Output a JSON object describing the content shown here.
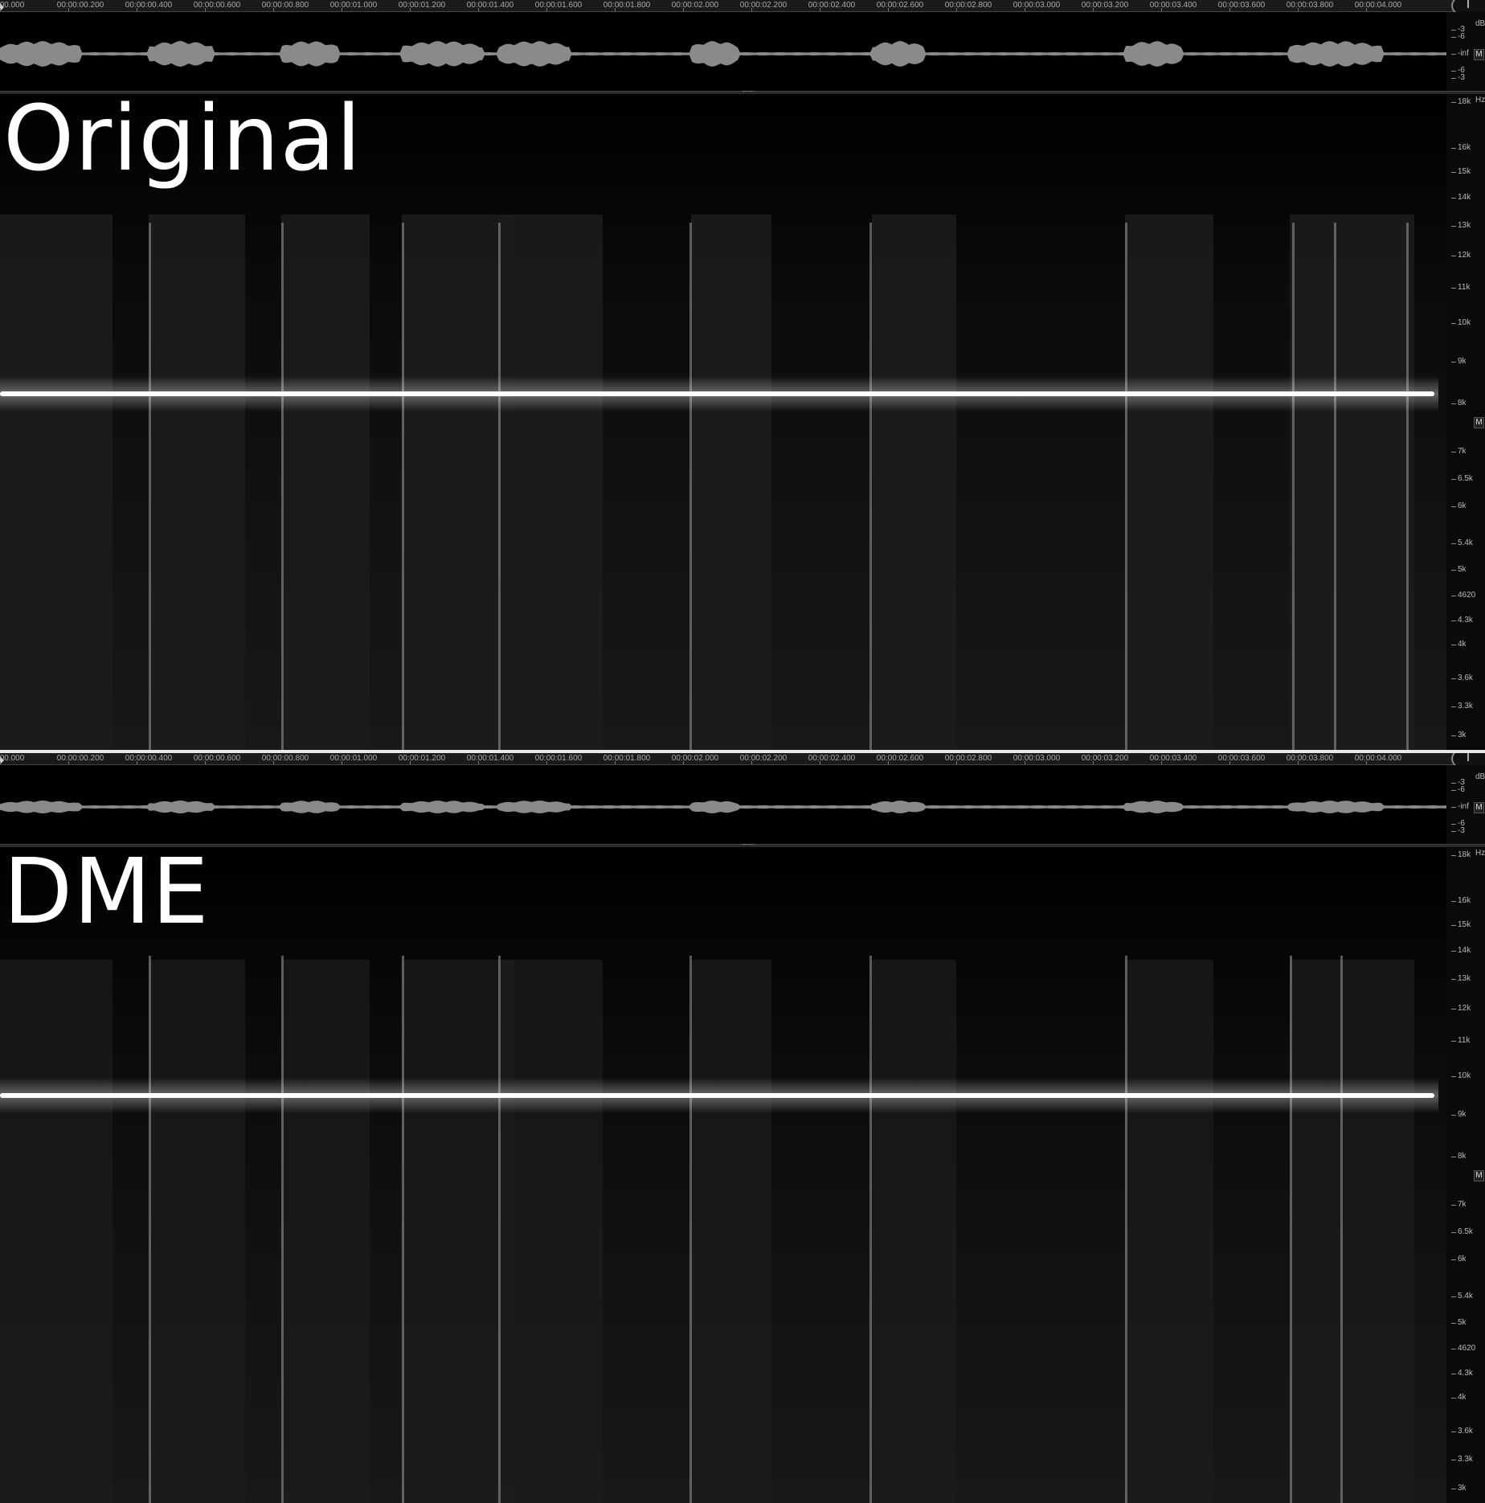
{
  "time_ruler": {
    "labels": [
      "00.000",
      "00:00:00.200",
      "00:00:00.400",
      "00:00:00.600",
      "00:00:00.800",
      "00:00:01.000",
      "00:00:01.200",
      "00:00:01.400",
      "00:00:01.600",
      "00:00:01.800",
      "00:00:02.000",
      "00:00:02.200",
      "00:00:02.400",
      "00:00:02.600",
      "00:00:02.800",
      "00:00:03.000",
      "00:00:03.200",
      "00:00:03.400",
      "00:00:03.600",
      "00:00:03.800",
      "00:00:04.000"
    ]
  },
  "db_scale": {
    "unit": "dB",
    "labels": [
      "-3",
      "-6",
      "-inf",
      "-6",
      "-3"
    ],
    "channel_badge": "M"
  },
  "freq_scale": {
    "unit": "Hz",
    "labels": [
      "18k",
      "16k",
      "15k",
      "14k",
      "13k",
      "12k",
      "11k",
      "10k",
      "9k",
      "8k",
      "7k",
      "6.5k",
      "6k",
      "5.4k",
      "5k",
      "4620",
      "4.3k",
      "4k",
      "3.6k",
      "3.3k",
      "3k"
    ],
    "channel_badge": "M"
  },
  "panels": [
    {
      "title": "Original"
    },
    {
      "title": "DME"
    }
  ],
  "colors": {
    "background": "#000000",
    "waveform": "#8a8a8a",
    "tone_line": "#ffffff",
    "divider": "#e8e8e8"
  }
}
